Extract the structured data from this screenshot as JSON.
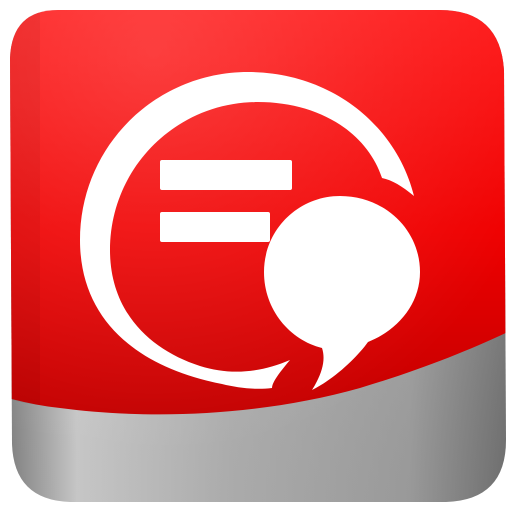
{
  "icon": {
    "name": "chat-messenger-app-icon",
    "glyph": "speech-bubbles-icon",
    "colors": {
      "red_top": "#f80606",
      "red_bottom": "#c90000",
      "silver_light": "#f2f2f2",
      "silver_dark": "#9c9c9c",
      "glyph": "#ffffff"
    }
  }
}
